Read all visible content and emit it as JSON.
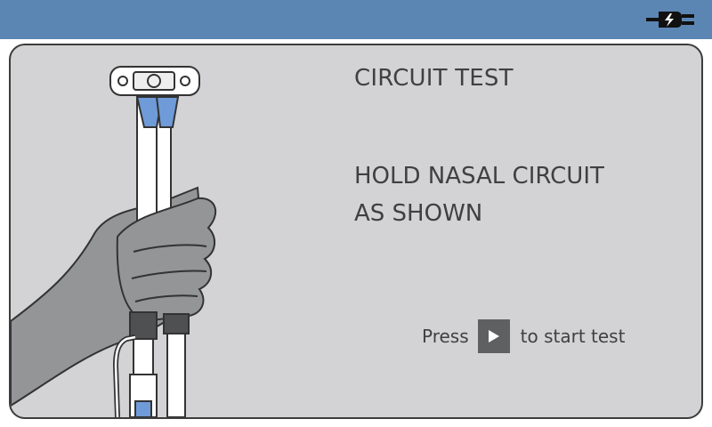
{
  "header": {
    "power_icon": "ac-power-plug-icon",
    "background_color": "#5b86b4"
  },
  "panel": {
    "title": "CIRCUIT TEST",
    "instruction_lines": [
      "HOLD NASAL CIRCUIT",
      "AS SHOWN"
    ],
    "press_label": "Press",
    "play_icon": "play-icon",
    "start_label": "to start test",
    "illustration": "hand-holding-nasal-circuit-illustration"
  }
}
